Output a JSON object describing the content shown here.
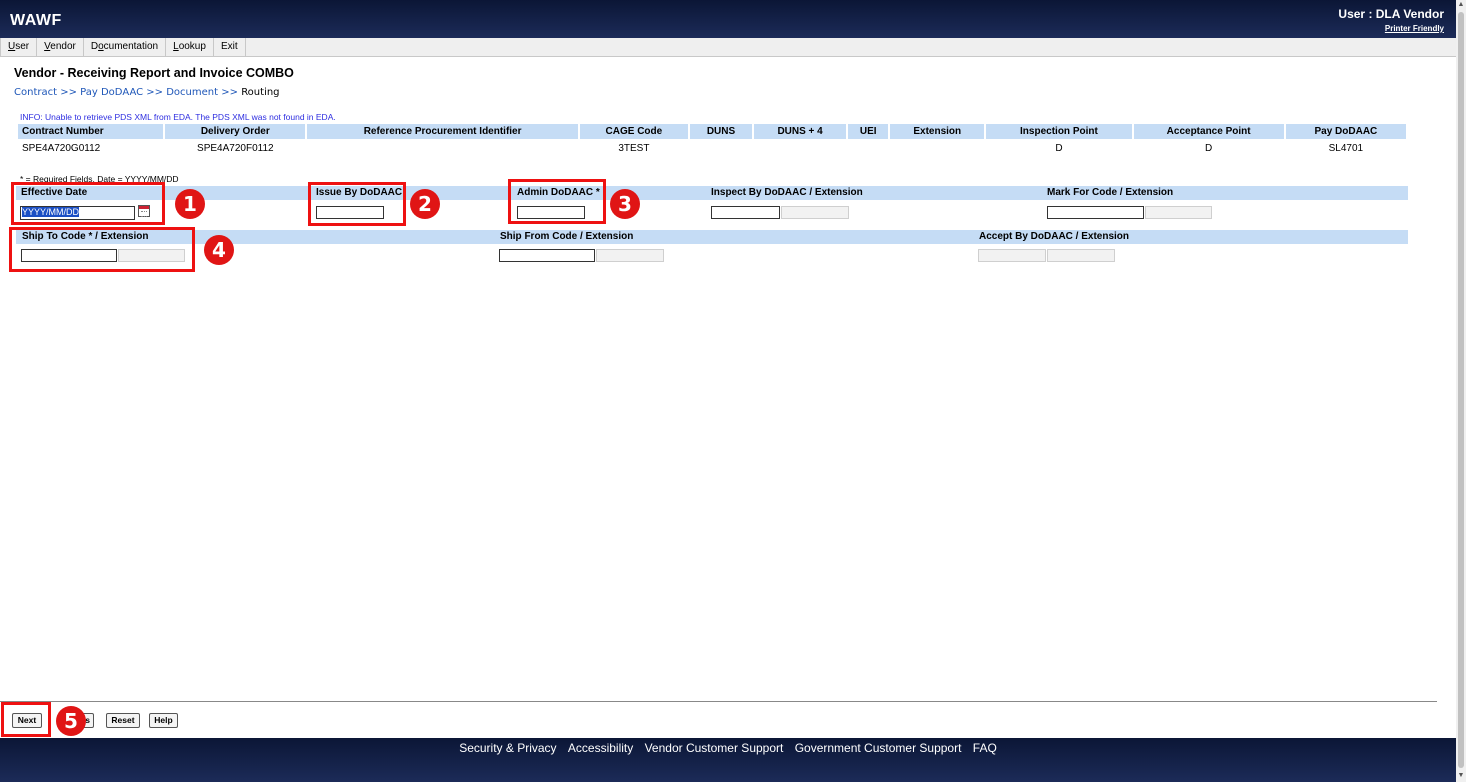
{
  "header": {
    "app_title": "WAWF",
    "user_label": "User : DLA Vendor",
    "printer_friendly": "Printer Friendly"
  },
  "menu": [
    "User",
    "Vendor",
    "Documentation",
    "Lookup",
    "Exit"
  ],
  "page_title": "Vendor - Receiving Report and Invoice COMBO",
  "breadcrumb": {
    "items": [
      "Contract",
      "Pay DoDAAC",
      "Document"
    ],
    "current": "Routing",
    "separator": ">>"
  },
  "info_message": "INFO: Unable to retrieve PDS XML from EDA. The PDS XML was not found in EDA.",
  "contract_table": {
    "headers": [
      "Contract Number",
      "Delivery Order",
      "Reference Procurement Identifier",
      "CAGE Code",
      "DUNS",
      "DUNS + 4",
      "UEI",
      "Extension",
      "Inspection Point",
      "Acceptance Point",
      "Pay DoDAAC"
    ],
    "row": [
      "SPE4A720G0112",
      "SPE4A720F0112",
      "",
      "3TEST",
      "",
      "",
      "",
      "",
      "D",
      "D",
      "SL4701"
    ]
  },
  "required_note": "* = Required Fields, Date = YYYY/MM/DD",
  "fields": {
    "effective_date": {
      "label": "Effective Date",
      "value": "YYYY/MM/DD"
    },
    "issue_by": {
      "label": "Issue By DoDAAC"
    },
    "admin": {
      "label": "Admin DoDAAC *"
    },
    "inspect_by": {
      "label": "Inspect By DoDAAC / Extension"
    },
    "mark_for": {
      "label": "Mark For Code / Extension"
    },
    "ship_to": {
      "label": "Ship To Code * / Extension"
    },
    "ship_from": {
      "label": "Ship From Code / Extension"
    },
    "accept_by": {
      "label": "Accept By DoDAAC / Extension"
    }
  },
  "buttons": {
    "next": "Next",
    "previous": "s",
    "reset": "Reset",
    "help": "Help"
  },
  "badges": [
    "1",
    "2",
    "3",
    "4",
    "5"
  ],
  "footer_links": [
    "Security & Privacy",
    "Accessibility",
    "Vendor Customer Support",
    "Government Customer Support",
    "FAQ"
  ],
  "colors": {
    "header_bg": "#0b1636",
    "header_bar": "#c5dcf5",
    "highlight_red": "#e11111",
    "link_blue": "#1f57b8",
    "info_text": "#2e2ee0"
  }
}
